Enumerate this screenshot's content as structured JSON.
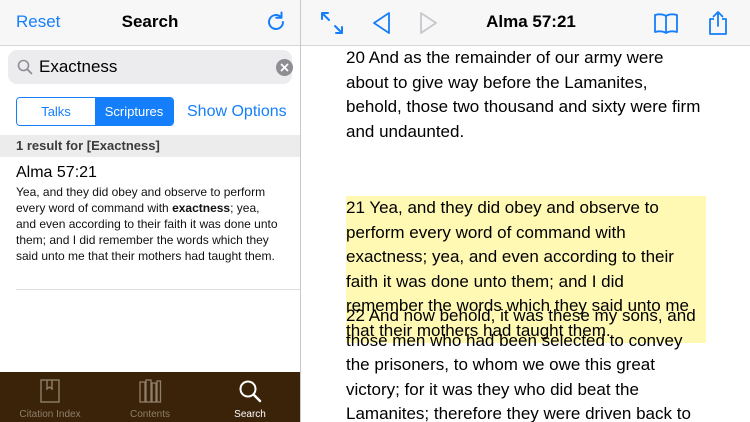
{
  "left_nav": {
    "reset": "Reset",
    "title": "Search"
  },
  "search": {
    "query": "Exactness"
  },
  "segments": {
    "talks": "Talks",
    "scriptures": "Scriptures",
    "show_options": "Show Options"
  },
  "results_header": "1 result for [Exactness]",
  "result": {
    "reference": "Alma 57:21",
    "before": "Yea, and they did obey and observe to perform every word of command with ",
    "match": "exactness",
    "after": "; yea, and even according to their faith it was done unto them; and I did remember the words which they said unto me that their mothers had taught them."
  },
  "tabs": [
    {
      "label": "Citation Index",
      "icon": "bookmark-book-icon"
    },
    {
      "label": "Contents",
      "icon": "books-icon"
    },
    {
      "label": "Search",
      "icon": "search-icon"
    }
  ],
  "right_nav": {
    "title": "Alma 57:21"
  },
  "verses": {
    "v20": "20 And as the remainder of our army were about to give way before the Lamanites, behold, those two thousand and sixty were firm and undaunted.",
    "v21": "21 Yea, and they did obey and observe to perform every word of command with exactness; yea, and even according to their faith it was done unto them; and I did remember the words which they said unto me that their mothers had taught them.",
    "v22": "22 And now behold, it was these my sons, and those men who had been selected to convey the prisoners, to whom we owe this great victory; for it was they who did beat the Lamanites; therefore they were driven back to"
  },
  "colors": {
    "accent": "#157efb",
    "highlight": "#fff9b4",
    "tabbar": "#3a2309"
  }
}
